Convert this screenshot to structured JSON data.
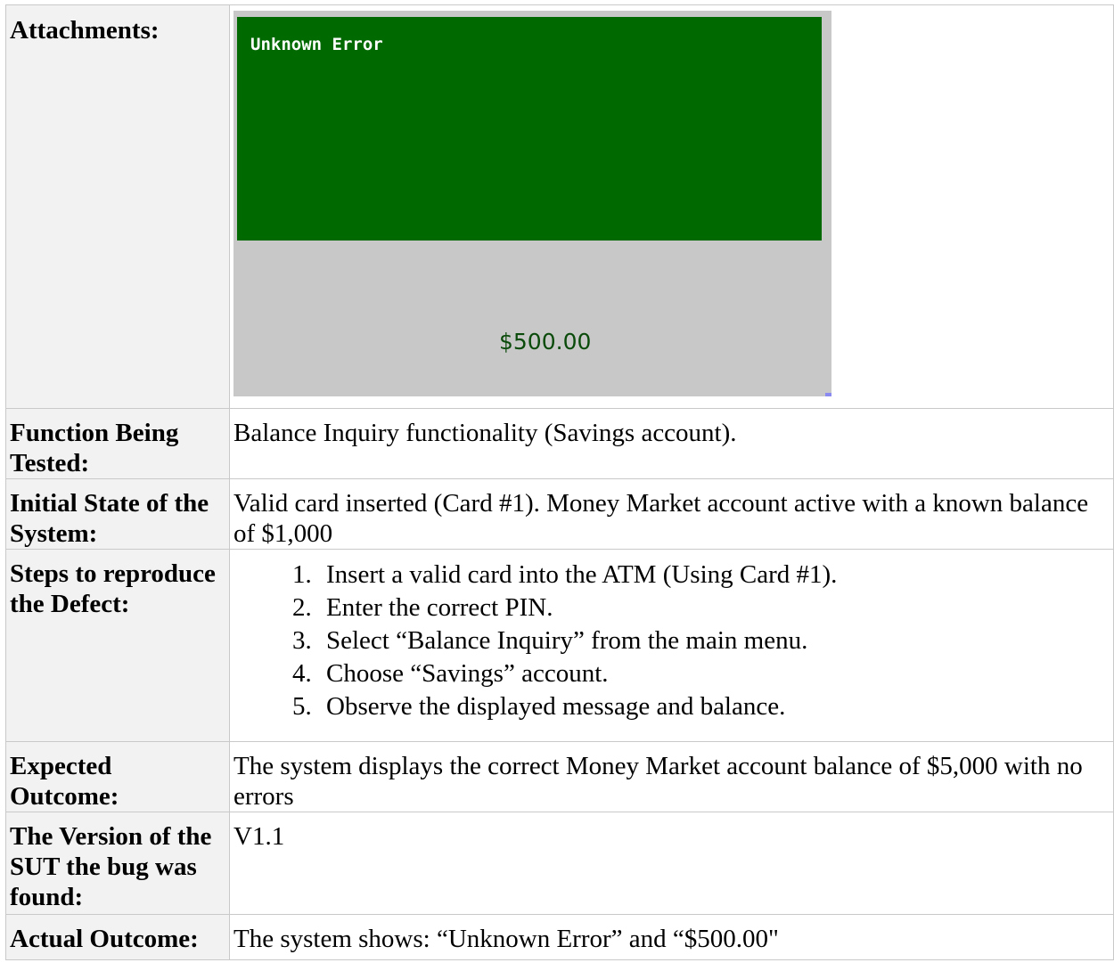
{
  "rows": {
    "attachments": {
      "label": "Attachments:",
      "screenshot": {
        "message": "Unknown Error",
        "balance": "$500.00",
        "screen_color": "#006a00",
        "frame_color": "#c8c8c8"
      }
    },
    "function": {
      "label": "Function Being Tested:",
      "value": "Balance Inquiry functionality (Savings account)."
    },
    "initial_state": {
      "label": "Initial State of the System:",
      "value": "Valid card inserted (Card #1). Money Market account active with a known balance of $1,000"
    },
    "steps": {
      "label": "Steps to reproduce the Defect:",
      "items": [
        "Insert a valid card into the ATM (Using Card #1).",
        "Enter the correct PIN.",
        "Select “Balance Inquiry” from the main menu.",
        "Choose “Savings” account.",
        "Observe the displayed message and balance."
      ]
    },
    "expected": {
      "label": "Expected Outcome:",
      "value": "The system displays the correct Money Market account balance of $5,000 with no errors"
    },
    "version": {
      "label": "The Version of the SUT the bug was found:",
      "value": "V1.1"
    },
    "actual": {
      "label": "Actual Outcome:",
      "value": "The system shows: “Unknown Error” and “$500.00\""
    }
  }
}
